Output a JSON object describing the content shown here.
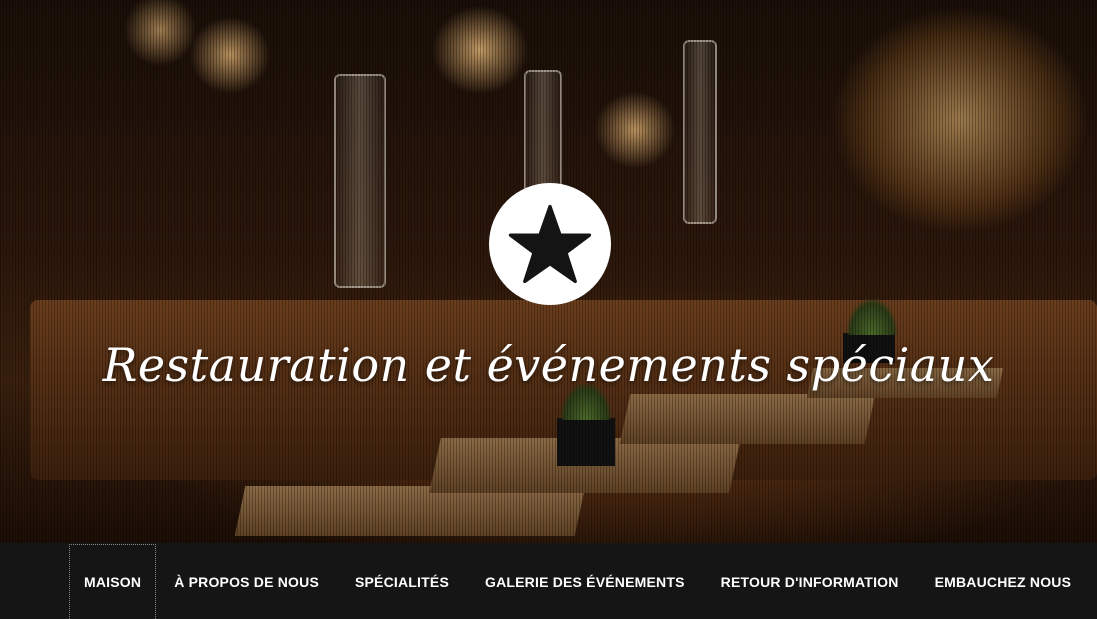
{
  "hero": {
    "title": "Restauration et événements spéciaux",
    "logo_icon": "star-icon",
    "accent_color": "#ffffff"
  },
  "nav": {
    "items": [
      {
        "label": "MAISON",
        "active": true
      },
      {
        "label": "À PROPOS DE NOUS",
        "active": false
      },
      {
        "label": "SPÉCIALITÉS",
        "active": false
      },
      {
        "label": "GALERIE DES ÉVÉNEMENTS",
        "active": false
      },
      {
        "label": "RETOUR D'INFORMATION",
        "active": false
      },
      {
        "label": "EMBAUCHEZ NOUS",
        "active": false
      }
    ],
    "background_color": "#151515"
  }
}
